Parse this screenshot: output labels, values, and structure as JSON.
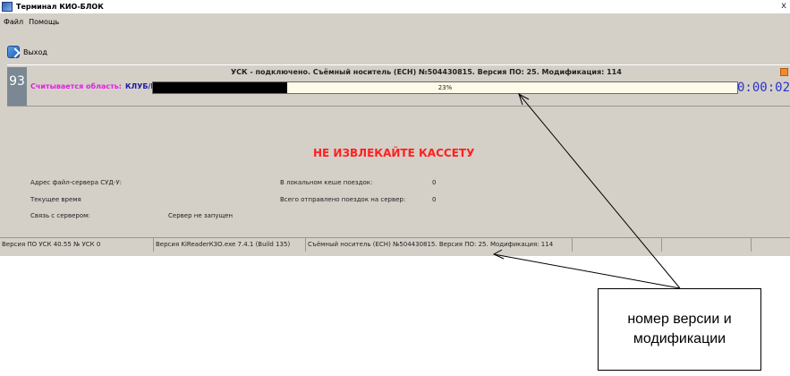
{
  "window": {
    "title": "Терминал КИО-БЛОК",
    "close_glyph": "x"
  },
  "menu": {
    "items": [
      "Файл",
      "Помощь"
    ]
  },
  "toolbar": {
    "exit_label": "Выход"
  },
  "status": {
    "counter": "93",
    "connection_title": "УСК - подключено. Съёмный носитель (ECH) №504430815. Версия ПО: 25. Модификация: 114",
    "read_area_label": "Считывается область:",
    "read_area_value": "КЛУБ/БЛОК",
    "progress_percent": 23,
    "progress_text": "23%",
    "timer": "0:00:02"
  },
  "warning": "НЕ ИЗВЛЕКАЙТЕ КАССЕТУ",
  "info": {
    "server_address_label": "Адрес файл-сервера СУД-У:",
    "current_time_label": "Текущее время",
    "server_link_label": "Связь с сервером:",
    "server_link_value": "Сервер не запущен",
    "local_cache_label": "В локальном кеше поездок:",
    "local_cache_value": "0",
    "sent_label": "Всего отправлено поездок на сервер:",
    "sent_value": "0"
  },
  "statusbar": {
    "cells": [
      "Версия ПО УСК 40.55   № УСК 0",
      "Версия KiReaderКЗО.exe 7.4.1 (Build 135)",
      "Съёмный носитель (ECH) №504430815. Версия ПО: 25. Модификация: 114",
      "",
      "",
      ""
    ]
  },
  "callout": {
    "line1": "номер версии и",
    "line2": "модификации"
  }
}
